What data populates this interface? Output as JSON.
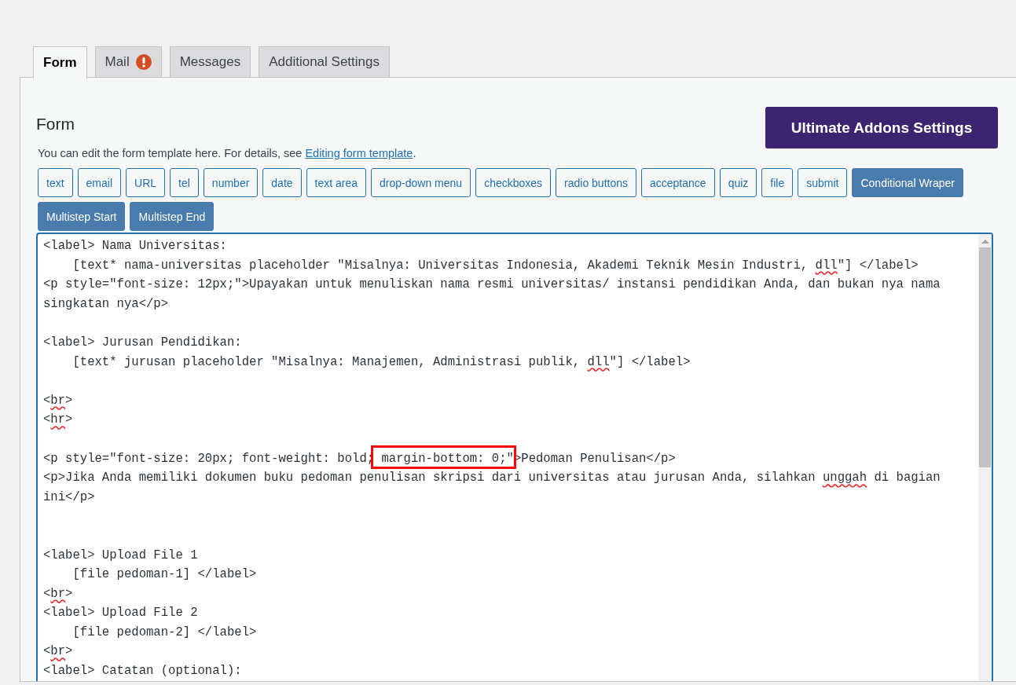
{
  "tabs": [
    {
      "label": "Form",
      "selected": true
    },
    {
      "label": "Mail",
      "selected": false,
      "alert": true
    },
    {
      "label": "Messages",
      "selected": false
    },
    {
      "label": "Additional Settings",
      "selected": false
    }
  ],
  "panel": {
    "title": "Form",
    "addons_button": "Ultimate Addons Settings",
    "description": "You can edit the form template here. For details, see ",
    "description_link": "Editing form template",
    "description_end": ".",
    "tag_buttons": [
      {
        "label": "text",
        "kind": "tag"
      },
      {
        "label": "email",
        "kind": "tag"
      },
      {
        "label": "URL",
        "kind": "tag"
      },
      {
        "label": "tel",
        "kind": "tag"
      },
      {
        "label": "number",
        "kind": "tag"
      },
      {
        "label": "date",
        "kind": "tag"
      },
      {
        "label": "text area",
        "kind": "tag"
      },
      {
        "label": "drop-down menu",
        "kind": "tag"
      },
      {
        "label": "checkboxes",
        "kind": "tag"
      },
      {
        "label": "radio buttons",
        "kind": "tag"
      },
      {
        "label": "acceptance",
        "kind": "tag"
      },
      {
        "label": "quiz",
        "kind": "tag"
      },
      {
        "label": "file",
        "kind": "tag"
      },
      {
        "label": "submit",
        "kind": "tag"
      },
      {
        "label": "Conditional Wraper",
        "kind": "addon"
      },
      {
        "label": "Multistep Start",
        "kind": "addon"
      },
      {
        "label": "Multistep End",
        "kind": "addon"
      }
    ],
    "editor": {
      "lines": [
        {
          "kind": "code",
          "segments": [
            {
              "text": "<label> Nama Universitas:"
            }
          ]
        },
        {
          "kind": "code",
          "segments": [
            {
              "text": "    [text* nama-universitas placeholder \"Misalnya: Universitas Indonesia, Akademi Teknik Mesin Industri, "
            },
            {
              "text": "dll",
              "misspelled": true
            },
            {
              "text": "\"] </label>"
            }
          ]
        },
        {
          "kind": "code",
          "segments": [
            {
              "text": "<p style=\"font-size: 12px;\">Upayakan untuk menuliskan nama resmi universitas/ instansi pendidikan Anda, dan bukan nya nama"
            }
          ]
        },
        {
          "kind": "code",
          "segments": [
            {
              "text": "singkatan nya</p>"
            }
          ]
        },
        {
          "kind": "blank"
        },
        {
          "kind": "code",
          "segments": [
            {
              "text": "<label> Jurusan Pendidikan:"
            }
          ]
        },
        {
          "kind": "code",
          "segments": [
            {
              "text": "    [text* jurusan placeholder \"Misalnya: Manajemen, Administrasi publik, "
            },
            {
              "text": "dll",
              "misspelled": true
            },
            {
              "text": "\"] </label>"
            }
          ]
        },
        {
          "kind": "blank"
        },
        {
          "kind": "code",
          "segments": [
            {
              "text": "<"
            },
            {
              "text": "br",
              "misspelled": true
            },
            {
              "text": ">"
            }
          ]
        },
        {
          "kind": "code",
          "segments": [
            {
              "text": "<"
            },
            {
              "text": "hr",
              "misspelled": true
            },
            {
              "text": ">"
            }
          ]
        },
        {
          "kind": "blank"
        },
        {
          "kind": "code",
          "segments": [
            {
              "text": "<p style=\"font-size: 20px; font-weight: bold;"
            },
            {
              "text": " margin-bottom: 0;\"",
              "highlighted": true
            },
            {
              "text": ">Pedoman Penulisan</p>"
            }
          ]
        },
        {
          "kind": "code",
          "segments": [
            {
              "text": "<p>Jika Anda memiliki dokumen buku pedoman penulisan skripsi dari universitas atau jurusan Anda, silahkan "
            },
            {
              "text": "unggah",
              "misspelled": true
            },
            {
              "text": " di bagian"
            }
          ]
        },
        {
          "kind": "code",
          "segments": [
            {
              "text": "ini</p>"
            }
          ]
        },
        {
          "kind": "blank"
        },
        {
          "kind": "blank"
        },
        {
          "kind": "code",
          "segments": [
            {
              "text": "<label> Upload File 1"
            }
          ]
        },
        {
          "kind": "code",
          "segments": [
            {
              "text": "    [file pedoman-1] </label>"
            }
          ]
        },
        {
          "kind": "code",
          "segments": [
            {
              "text": "<"
            },
            {
              "text": "br",
              "misspelled": true
            },
            {
              "text": ">"
            }
          ]
        },
        {
          "kind": "code",
          "segments": [
            {
              "text": "<label> Upload File 2"
            }
          ]
        },
        {
          "kind": "code",
          "segments": [
            {
              "text": "    [file pedoman-2] </label>"
            }
          ]
        },
        {
          "kind": "code",
          "segments": [
            {
              "text": "<"
            },
            {
              "text": "br",
              "misspelled": true
            },
            {
              "text": ">"
            }
          ]
        },
        {
          "kind": "code",
          "segments": [
            {
              "text": "<label> Catatan (optional):"
            }
          ]
        }
      ]
    }
  }
}
